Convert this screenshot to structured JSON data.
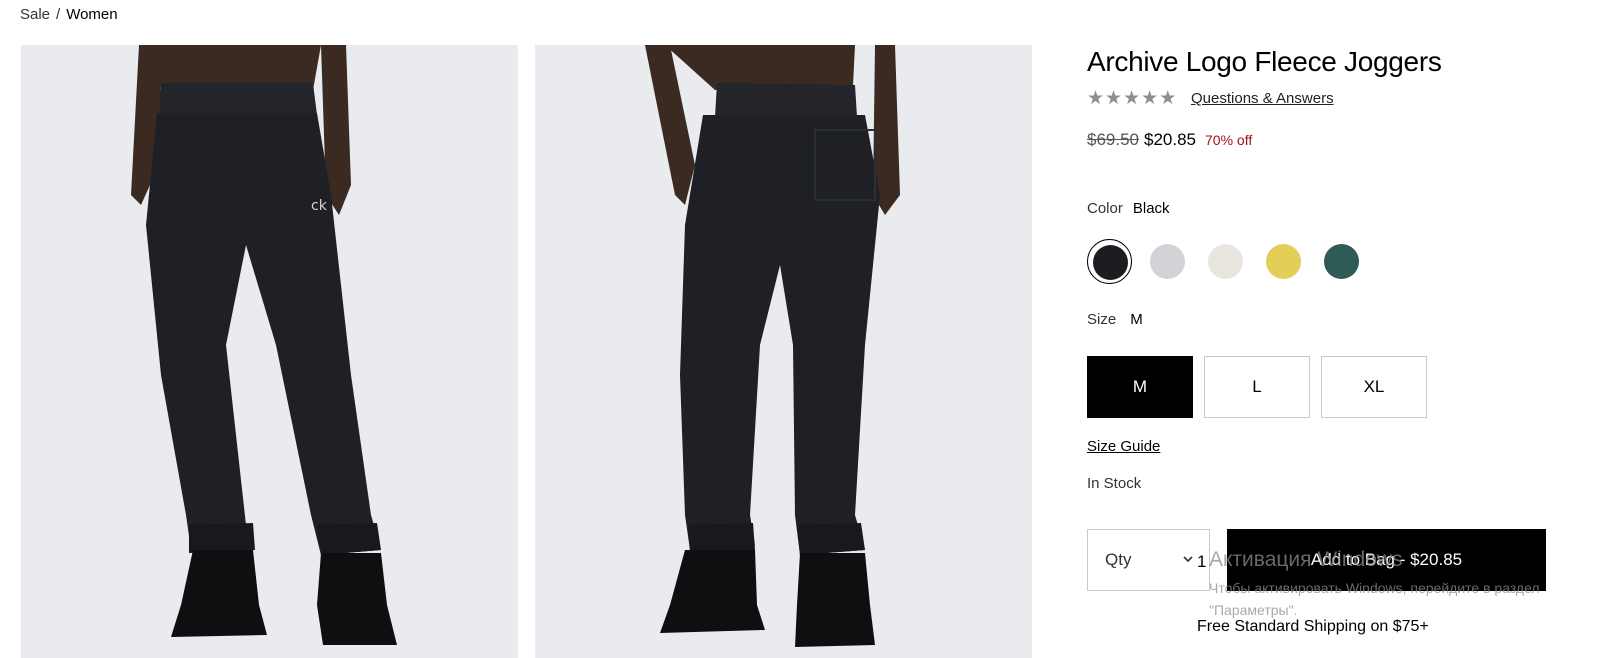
{
  "breadcrumb": {
    "sale": "Sale",
    "separator": "/",
    "current": "Women"
  },
  "product": {
    "title": "Archive Logo Fleece Joggers",
    "rating": {
      "stars": 5,
      "filled": 0
    },
    "qa_link": "Questions & Answers",
    "price": {
      "original": "$69.50",
      "sale": "$20.85",
      "discount": "70% off"
    },
    "color": {
      "label": "Color",
      "selected": "Black",
      "swatches": [
        {
          "name": "black",
          "hex": "#1b1d21"
        },
        {
          "name": "heather-grey",
          "hex": "#d4d2d6"
        },
        {
          "name": "cream",
          "hex": "#e8e6df"
        },
        {
          "name": "yellow",
          "hex": "#e3cf57"
        },
        {
          "name": "green",
          "hex": "#2f5b56"
        }
      ]
    },
    "size": {
      "label": "Size",
      "selected": "M",
      "options": [
        "M",
        "L",
        "XL"
      ]
    },
    "size_guide": "Size Guide",
    "stock": "In Stock",
    "qty": {
      "label": "Qty",
      "value": "1"
    },
    "add_to_bag": "Add to Bag - $20.85",
    "shipping": "Free Standard Shipping on $75+"
  },
  "windows_watermark": {
    "title": "Активация Windows",
    "body": "Чтобы активировать Windows, перейдите в раздел \"Параметры\"."
  },
  "colors": {
    "accent_discount": "#a3101a",
    "button_bg": "#000000",
    "image_bg": "#e9ebee"
  }
}
